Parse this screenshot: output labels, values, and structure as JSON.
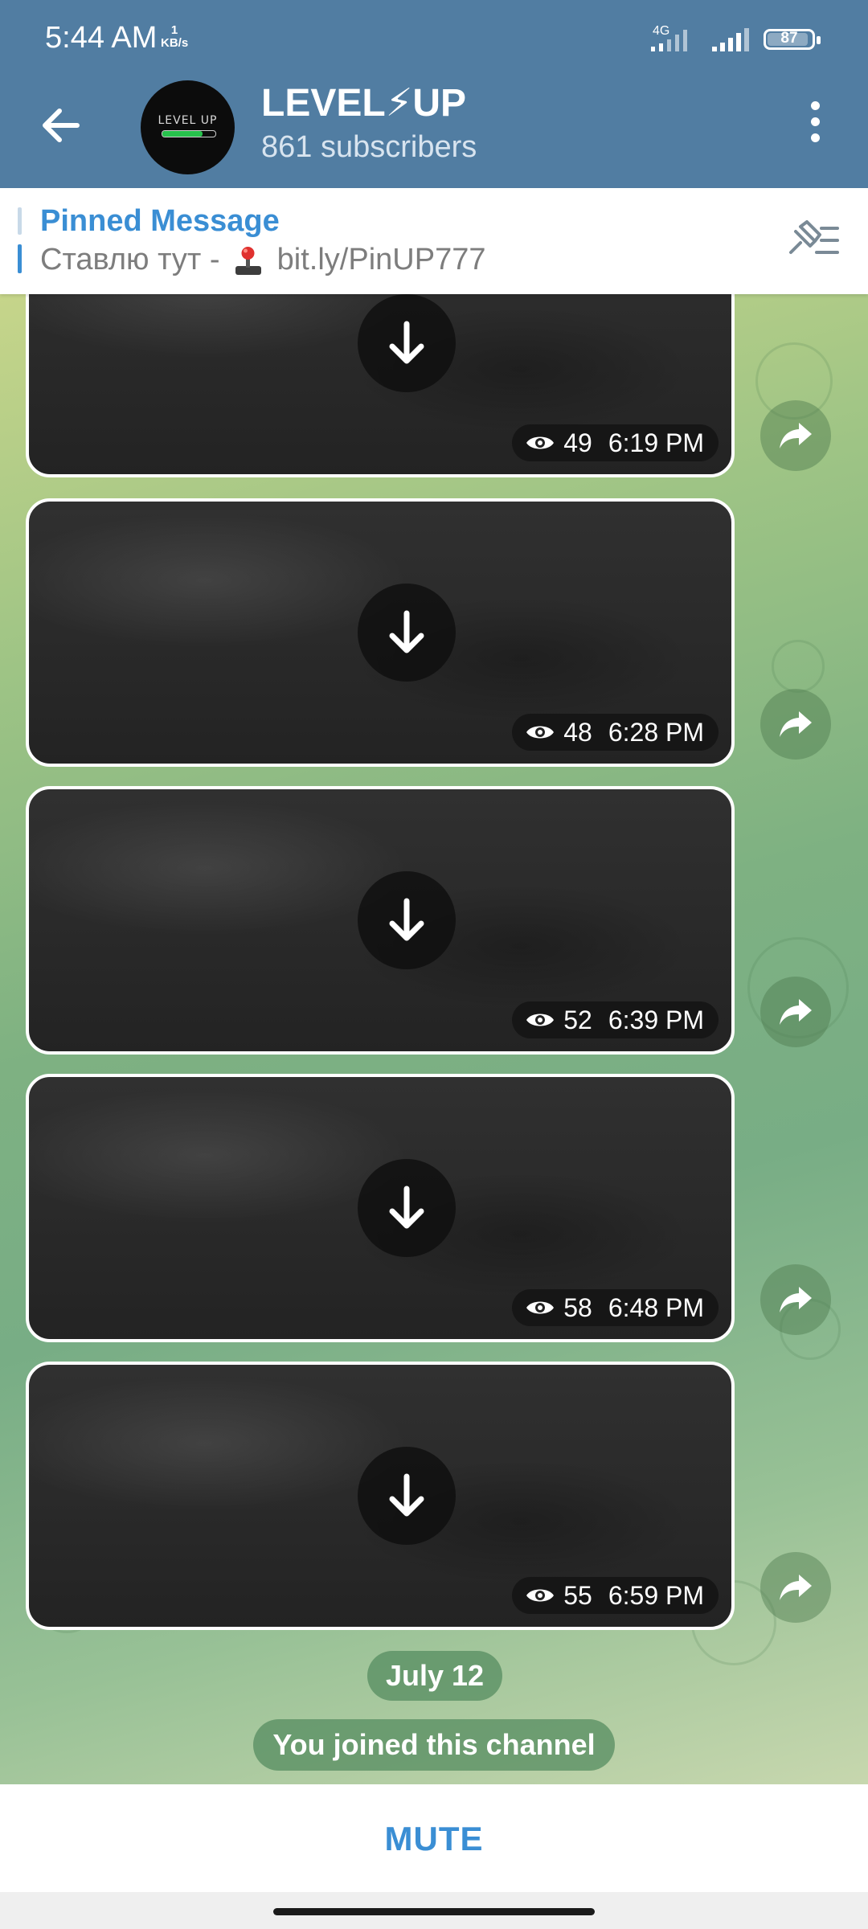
{
  "status_bar": {
    "time": "5:44 AM",
    "net_speed_value": "1",
    "net_speed_unit": "KB/s",
    "network_type": "4G",
    "battery": "87"
  },
  "header": {
    "title": "LEVEL⚡UP",
    "subtitle": "861 subscribers",
    "avatar_text": "LEVEL UP",
    "icons": [
      "back-arrow-icon",
      "more-vert-icon"
    ]
  },
  "pinned": {
    "title": "Pinned Message",
    "text_prefix": "Ставлю тут -",
    "text_link": "bit.ly/PinUP777",
    "icons": [
      "joystick-icon",
      "unpin-list-icon"
    ]
  },
  "messages": [
    {
      "views": "49",
      "time": "6:19 PM"
    },
    {
      "views": "48",
      "time": "6:28 PM"
    },
    {
      "views": "52",
      "time": "6:39 PM"
    },
    {
      "views": "58",
      "time": "6:48 PM"
    },
    {
      "views": "55",
      "time": "6:59 PM"
    }
  ],
  "service": {
    "date": "July 12",
    "joined": "You joined this channel"
  },
  "bottom": {
    "mute_label": "MUTE"
  },
  "colors": {
    "header": "#517da2",
    "accent": "#3a8ed4",
    "service_pill": "#568c60"
  }
}
